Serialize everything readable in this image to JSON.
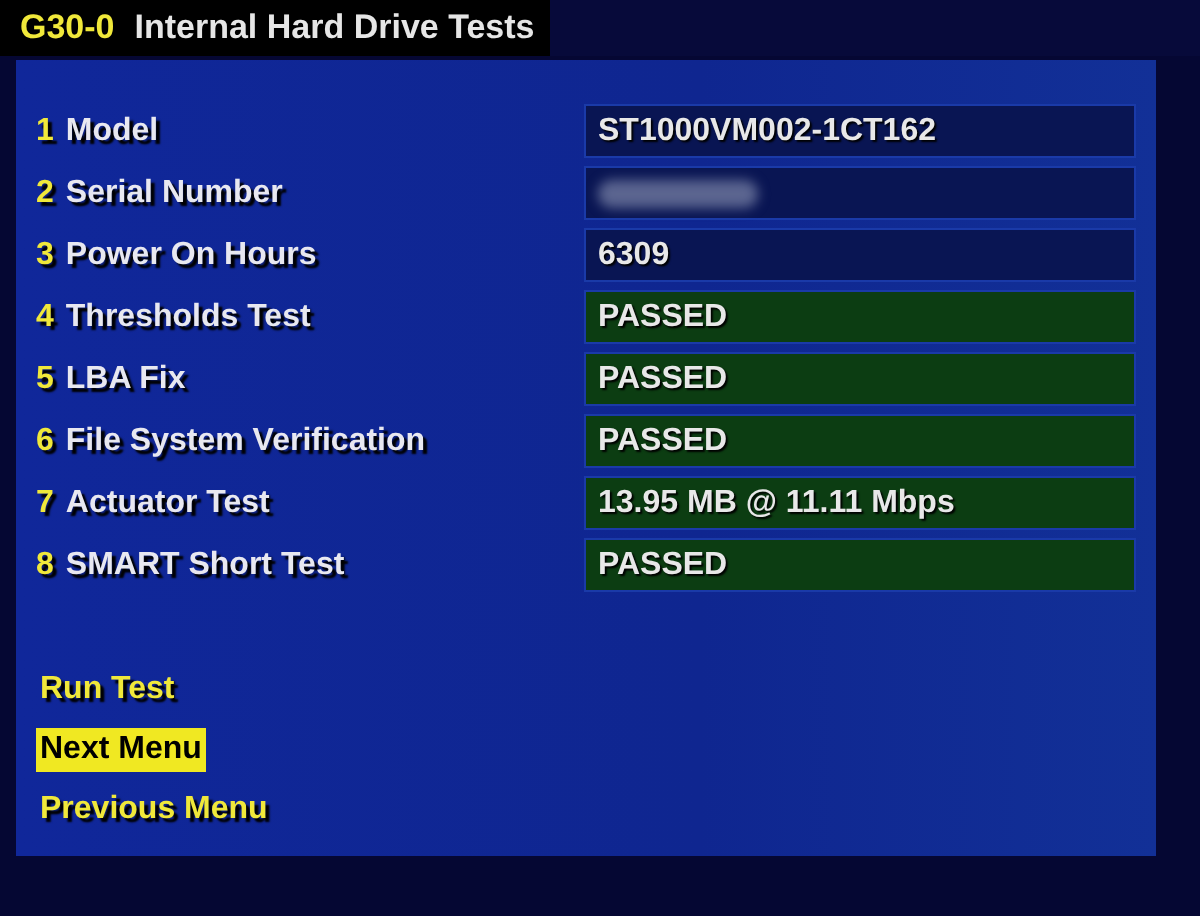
{
  "header": {
    "code": "G30-0",
    "title": "Internal Hard Drive Tests"
  },
  "rows": [
    {
      "number": "1",
      "label": "Model",
      "kind": "info",
      "value": "ST1000VM002-1CT162"
    },
    {
      "number": "2",
      "label": "Serial Number",
      "kind": "info",
      "redacted": true
    },
    {
      "number": "3",
      "label": "Power On Hours",
      "kind": "info",
      "value": "6309"
    },
    {
      "number": "4",
      "label": "Thresholds Test",
      "kind": "result",
      "value": "PASSED"
    },
    {
      "number": "5",
      "label": "LBA Fix",
      "kind": "result",
      "value": "PASSED"
    },
    {
      "number": "6",
      "label": "File System Verification",
      "kind": "result",
      "value": "PASSED"
    },
    {
      "number": "7",
      "label": "Actuator Test",
      "kind": "result",
      "value": "13.95 MB @ 11.11 Mbps"
    },
    {
      "number": "8",
      "label": "SMART Short Test",
      "kind": "result",
      "value": "PASSED"
    }
  ],
  "menu": [
    {
      "label": "Run Test",
      "selected": false
    },
    {
      "label": "Next Menu",
      "selected": true
    },
    {
      "label": "Previous Menu",
      "selected": false
    }
  ]
}
